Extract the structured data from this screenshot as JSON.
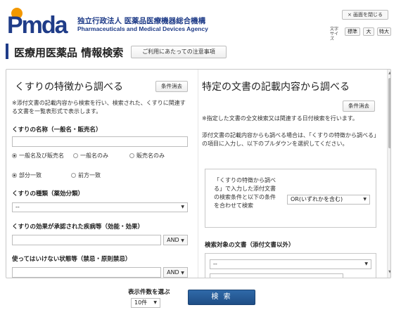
{
  "header": {
    "logo_text": "Pmda",
    "org_name_jp": "独立行政法人 医薬品医療機器総合機構",
    "org_name_en": "Pharmaceuticals and Medical Devices Agency",
    "close_label": "× 画面を閉じる",
    "font_size_label": "文字サイズ",
    "font_sizes": [
      "標準",
      "大",
      "特大"
    ]
  },
  "page": {
    "title": "医療用医薬品 情報検索",
    "notice_label": "ご利用にあたっての注意事項"
  },
  "left": {
    "title": "くすりの特徴から調べる",
    "clear_label": "条件消去",
    "description": "※添付文書の記載内容から検索を行い、検索された、くすりに関連する文書を一覧表形式で表示します。",
    "name_label": "くすりの名称（一般名・販売名）",
    "name_value": "",
    "name_scope_options": [
      "一般名及び販売名",
      "一般名のみ",
      "販売名のみ"
    ],
    "name_scope_selected": 0,
    "match_options": [
      "部分一致",
      "前方一致"
    ],
    "match_selected": 0,
    "type_label": "くすりの種類（薬効分類）",
    "type_value": "--",
    "disease_label": "くすりの効果が承認された疾病等（効能・効果）",
    "disease_op": "AND",
    "contra_label": "使ってはいけない状態等（禁忌・原則禁忌）",
    "contra_op": "AND"
  },
  "right": {
    "title": "特定の文書の記載内容から調べる",
    "clear_label": "条件消去",
    "description1": "※指定した文書の全文検索又は関連する日付検索を行います。",
    "description2": "添付文書の記載内容からも調べる場合は、「くすりの特徴から調べる」の項目に入力し、以下のプルダウンを選択してください。",
    "combine_text": "「くすりの特徴から調べる」で入力した添付文書の検索条件と以下の条件を合わせて検索",
    "combine_value": "OR(いずれかを含む)",
    "target_label": "検索対象の文書（添付文書以外）",
    "target_value": "--"
  },
  "bottom": {
    "count_label": "表示件数を選ぶ",
    "count_value": "10件",
    "search_label": "検 索"
  },
  "colors": {
    "brand": "#1f3c88",
    "logo_orange": "#f39800",
    "search_button": "#2a5d99"
  }
}
